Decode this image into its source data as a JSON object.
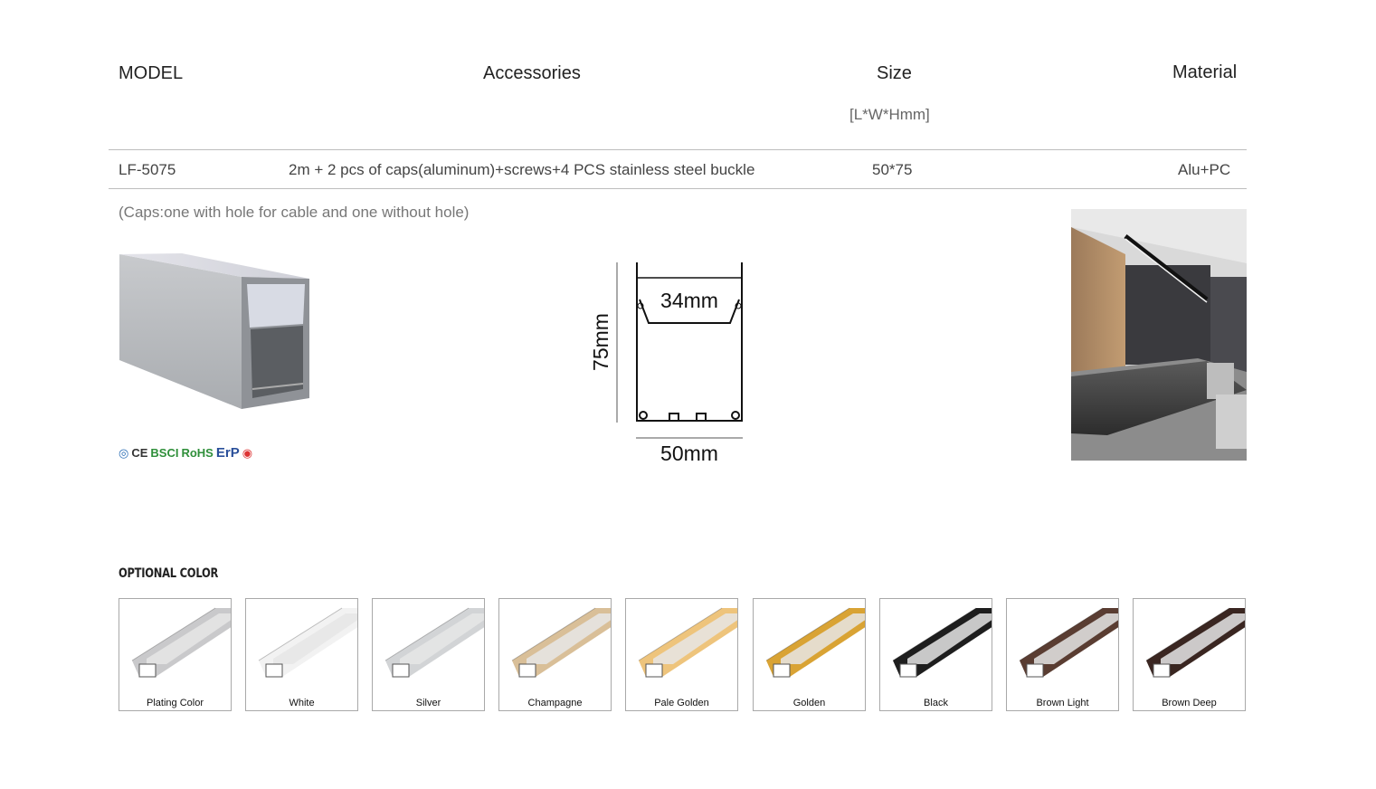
{
  "table": {
    "headers": {
      "model": "MODEL",
      "accessories": "Accessories",
      "size": "Size",
      "size_unit": "[L*W*Hmm]",
      "material": "Material"
    },
    "row": {
      "model": "LF-5075",
      "accessories": "2m + 2 pcs of caps(aluminum)+screws+4 PCS stainless steel buckle",
      "size": "50*75",
      "material": "Alu+PC"
    }
  },
  "note": "(Caps:one with hole for cable and one without hole)",
  "certifications": [
    "CE",
    "BSCI",
    "RoHS",
    "ErP"
  ],
  "dimensions": {
    "width": "50mm",
    "height": "75mm",
    "inner": "34mm"
  },
  "optional_color": {
    "title": "OPTIONAL COLOR",
    "swatches": [
      {
        "label": "Plating Color",
        "color": "#c9c9cb"
      },
      {
        "label": "White",
        "color": "#f2f2f2"
      },
      {
        "label": "Silver",
        "color": "#d2d4d6"
      },
      {
        "label": "Champagne",
        "color": "#d9bf98"
      },
      {
        "label": "Pale Golden",
        "color": "#eec47c"
      },
      {
        "label": "Golden",
        "color": "#d9a334"
      },
      {
        "label": "Black",
        "color": "#1e1e1e"
      },
      {
        "label": "Brown Light",
        "color": "#5a3d32"
      },
      {
        "label": "Brown Deep",
        "color": "#3a2621"
      }
    ]
  }
}
